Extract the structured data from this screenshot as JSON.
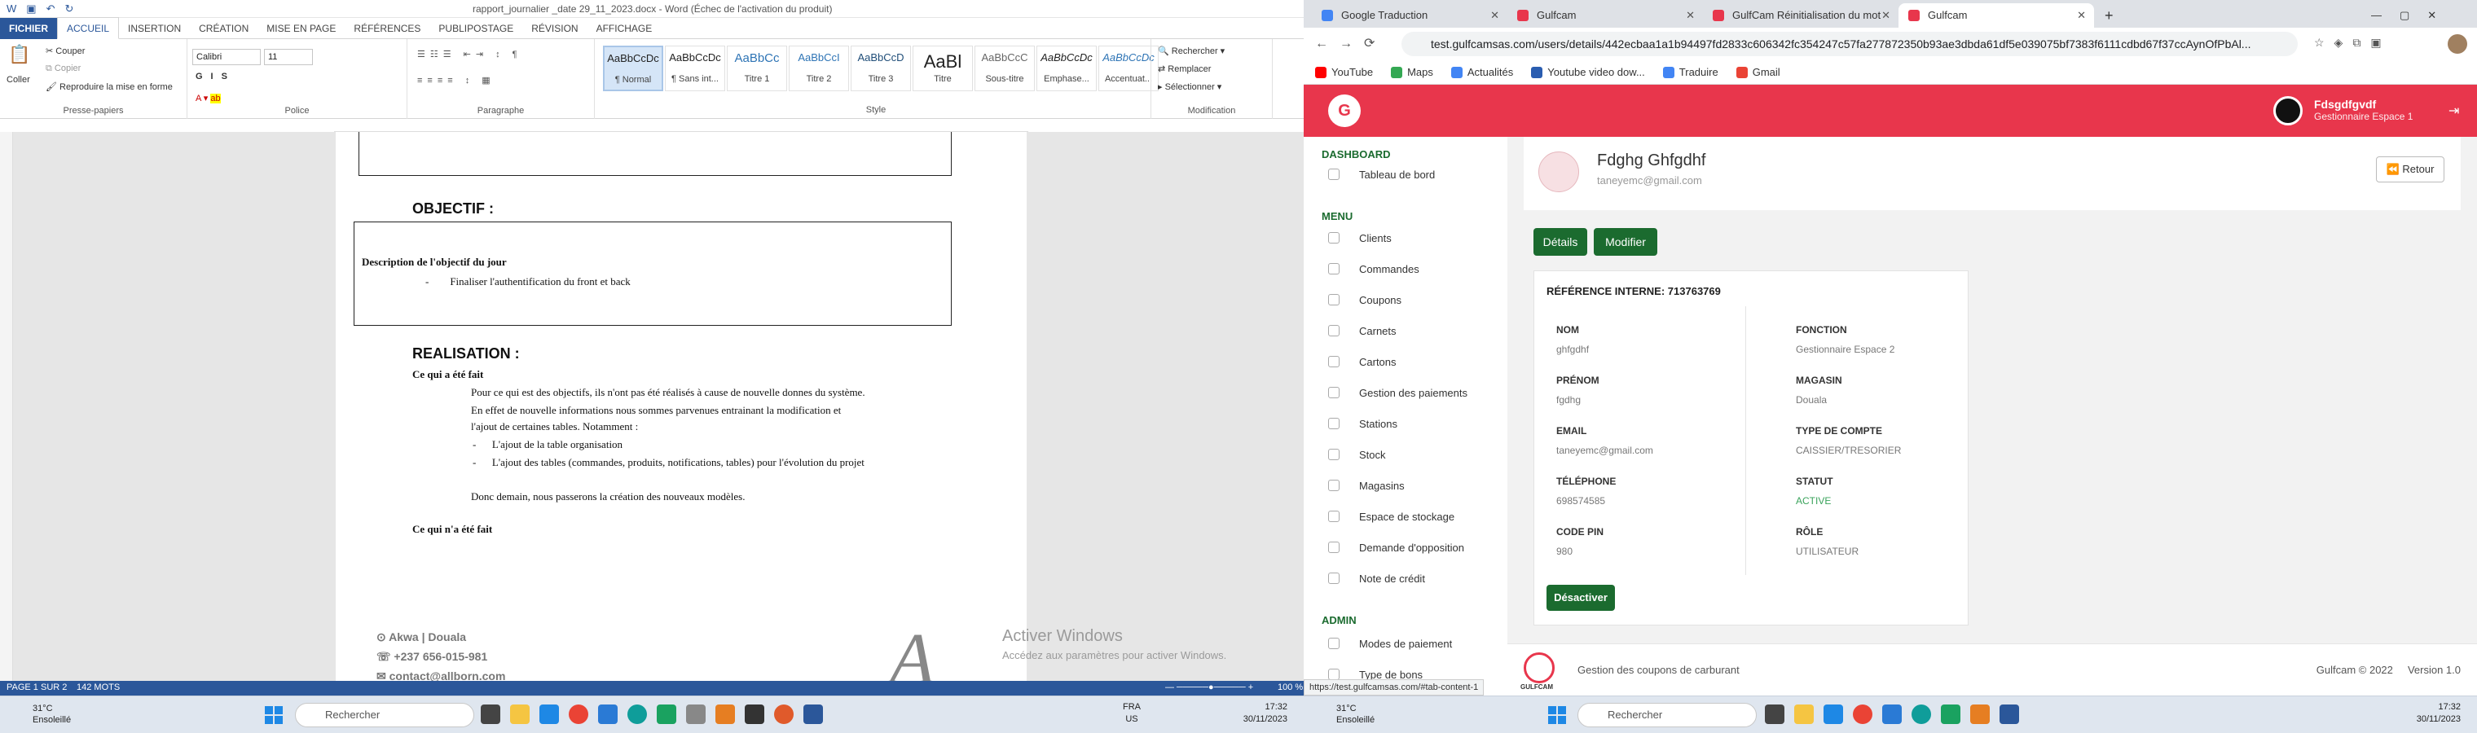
{
  "word": {
    "doc_title": "rapport_journalier _date 29_11_2023.docx - Word (Échec de l'activation du produit)",
    "tabs": [
      "FICHIER",
      "ACCUEIL",
      "INSERTION",
      "CRÉATION",
      "MISE EN PAGE",
      "RÉFÉRENCES",
      "PUBLIPOSTAGE",
      "RÉVISION",
      "AFFICHAGE"
    ],
    "clipboard": {
      "paste": "Coller",
      "cut": "Couper",
      "copy": "Copier",
      "format": "Reproduire la mise en forme",
      "label": "Presse-papiers"
    },
    "font": {
      "name": "Calibri",
      "size": "11",
      "label": "Police"
    },
    "paragraph_label": "Paragraphe",
    "styles": [
      {
        "preview": "AaBbCcDc",
        "name": "¶ Normal"
      },
      {
        "preview": "AaBbCcDc",
        "name": "¶ Sans int..."
      },
      {
        "preview": "AaBbCc",
        "name": "Titre 1"
      },
      {
        "preview": "AaBbCcI",
        "name": "Titre 2"
      },
      {
        "preview": "AaBbCcD",
        "name": "Titre 3"
      },
      {
        "preview": "AaBl",
        "name": "Titre"
      },
      {
        "preview": "AaBbCcC",
        "name": "Sous-titre"
      },
      {
        "preview": "AaBbCcDc",
        "name": "Emphase..."
      },
      {
        "preview": "AaBbCcDc",
        "name": "Accentuat..."
      }
    ],
    "styles_label": "Style",
    "edit": {
      "find": "Rechercher",
      "replace": "Remplacer",
      "select": "Sélectionner",
      "label": "Modification"
    },
    "doc": {
      "objectif_title": "OBJECTIF :",
      "objectif_desc": "Description de l'objectif du jour",
      "objectif_item": "-        Finaliser l'authentification du front et back",
      "realisation_title": "REALISATION :",
      "done_title": "Ce qui a été fait",
      "p1": "Pour ce qui est des objectifs, ils n'ont pas été réalisés à cause de nouvelle donnes du système.",
      "p2": "En effet de nouvelle informations nous sommes parvenues entrainant la modification et",
      "p3": "l'ajout de certaines tables. Notamment :",
      "b1": "-      L'ajout de la table organisation",
      "b2": "-      L'ajout des tables (commandes, produits, notifications, tables) pour l'évolution du projet",
      "p4": "Donc demain, nous passerons la création des nouveaux modèles.",
      "not_done_title": "Ce qui n'a été fait",
      "addr": "Akwa | Douala",
      "phone": "+237 656-015-981",
      "email": "contact@allborn.com"
    },
    "watermark": {
      "line1": "Activer Windows",
      "line2": "Accédez aux paramètres pour activer Windows."
    },
    "status": {
      "page": "PAGE 1 SUR 2",
      "words": "142 MOTS",
      "zoom": "100 %"
    }
  },
  "taskbar_left": {
    "temp": "31°C",
    "weather": "Ensoleillé",
    "search": "Rechercher",
    "lang1": "FRA",
    "lang2": "US",
    "time": "17:32",
    "date": "30/11/2023"
  },
  "chrome": {
    "tabs": [
      {
        "title": "Google Traduction",
        "color": "#4285f4"
      },
      {
        "title": "Gulfcam",
        "color": "#e8364c"
      },
      {
        "title": "GulfCam Réinitialisation du mot",
        "color": "#e8364c"
      },
      {
        "title": "Gulfcam",
        "color": "#e8364c"
      }
    ],
    "url": "test.gulfcamsas.com/users/details/442ecbaa1a1b94497fd2833c606342fc354247c57fa277872350b93ae3dbda61df5e039075bf7383f6111cdbd67f37ccAynOfPbAl...",
    "bookmarks": [
      "YouTube",
      "Maps",
      "Actualités",
      "Youtube video dow...",
      "Traduire",
      "Gmail"
    ],
    "status_url": "https://test.gulfcamsas.com/#tab-content-1"
  },
  "app": {
    "logo": "G",
    "user_name": "Fdsgdfgvdf",
    "user_role": "Gestionnaire Espace 1",
    "sections": {
      "dashboard": "DASHBOARD",
      "menu": "MENU",
      "admin": "ADMIN"
    },
    "dashboard_items": [
      "Tableau de bord"
    ],
    "menu_items": [
      "Clients",
      "Commandes",
      "Coupons",
      "Carnets",
      "Cartons",
      "Gestion des paiements",
      "Stations",
      "Stock",
      "Magasins",
      "Espace de stockage",
      "Demande d'opposition",
      "Note de crédit"
    ],
    "admin_items": [
      "Modes de paiement",
      "Type de bons"
    ],
    "profile": {
      "name": "Fdghg Ghfgdhf",
      "email": "taneyemc@gmail.com"
    },
    "retour": "Retour",
    "details_btn": "Détails",
    "modify_btn": "Modifier",
    "ref": "RÉFÉRENCE INTERNE: 713763769",
    "fields_left": [
      {
        "k": "NOM",
        "v": "ghfgdhf"
      },
      {
        "k": "PRÉNOM",
        "v": "fgdhg"
      },
      {
        "k": "EMAIL",
        "v": "taneyemc@gmail.com"
      },
      {
        "k": "TÉLÉPHONE",
        "v": "698574585"
      },
      {
        "k": "CODE PIN",
        "v": "980"
      }
    ],
    "fields_right": [
      {
        "k": "FONCTION",
        "v": "Gestionnaire Espace 2"
      },
      {
        "k": "MAGASIN",
        "v": "Douala"
      },
      {
        "k": "TYPE DE COMPTE",
        "v": "CAISSIER/TRESORIER"
      },
      {
        "k": "STATUT",
        "v": "ACTIVE"
      },
      {
        "k": "RÔLE",
        "v": "UTILISATEUR"
      }
    ],
    "deactivate": "Désactiver",
    "footer_text": "Gestion des coupons de carburant",
    "footer_copy": "Gulfcam © 2022",
    "footer_version": "Version 1.0",
    "footer_logo": "GULFCAM"
  },
  "taskbar_right": {
    "temp": "31°C",
    "weather": "Ensoleillé",
    "search": "Rechercher",
    "time": "17:32",
    "date": "30/11/2023"
  },
  "colors": {
    "word_blue": "#2b579a",
    "app_red": "#e8364c",
    "app_green": "#1b6b2f",
    "status_active": "#3aa35b"
  }
}
